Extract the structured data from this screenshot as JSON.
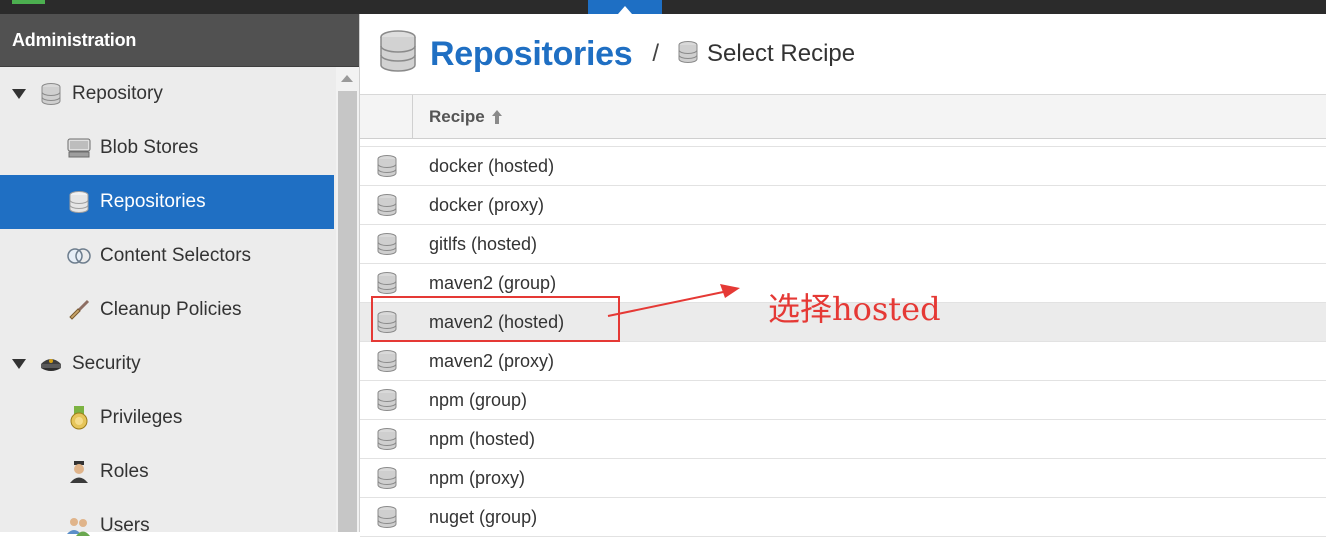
{
  "sidebar": {
    "header": "Administration",
    "items": [
      {
        "label": "Repository",
        "icon": "database-icon"
      },
      {
        "label": "Blob Stores",
        "icon": "server-icon"
      },
      {
        "label": "Repositories",
        "icon": "database-icon"
      },
      {
        "label": "Content Selectors",
        "icon": "content-selector-icon"
      },
      {
        "label": "Cleanup Policies",
        "icon": "broom-icon"
      },
      {
        "label": "Security",
        "icon": "police-cap-icon"
      },
      {
        "label": "Privileges",
        "icon": "medal-icon"
      },
      {
        "label": "Roles",
        "icon": "user-role-icon"
      },
      {
        "label": "Users",
        "icon": "users-icon"
      }
    ]
  },
  "breadcrumb": {
    "title": "Repositories",
    "separator": "/",
    "current": "Select Recipe"
  },
  "table": {
    "column_header": "Recipe",
    "rows": [
      "docker (hosted)",
      "docker (proxy)",
      "gitlfs (hosted)",
      "maven2 (group)",
      "maven2 (hosted)",
      "maven2 (proxy)",
      "npm (group)",
      "npm (hosted)",
      "npm (proxy)",
      "nuget (group)"
    ]
  },
  "annotation": {
    "text": "选择hosted",
    "color": "#e53935"
  },
  "colors": {
    "accent": "#1f6fc3",
    "header_bg": "#515151"
  }
}
